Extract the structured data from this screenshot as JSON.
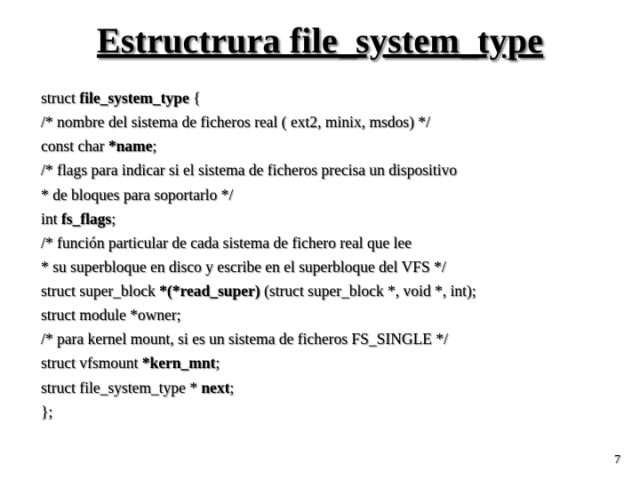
{
  "title": "Estructrura file_system_type",
  "code": {
    "l1a": "struct ",
    "l1b": "file_system_type",
    "l1c": " {",
    "l2": "/* nombre del sistema de ficheros real ( ext2, minix, msdos) */",
    "l3a": "const char ",
    "l3b": "*name",
    "l3c": ";",
    "l4": "/* flags para indicar si el sistema de ficheros precisa un dispositivo",
    "l5": "* de bloques para soportarlo */",
    "l6a": "int ",
    "l6b": "fs_flags",
    "l6c": ";",
    "l7": "/* función particular de cada sistema de fichero real que lee",
    "l8": "* su superbloque en disco y escribe en el superbloque del VFS */",
    "l9a": "struct super_block ",
    "l9b": "*(*read_super)",
    "l9c": " (struct super_block *, void *, int);",
    "l10": "struct module *owner;",
    "l11": "/* para kernel mount, si es un sistema de ficheros FS_SINGLE */",
    "l12a": "struct vfsmount ",
    "l12b": "*kern_mnt",
    "l12c": ";",
    "l13a": "struct file_system_type * ",
    "l13b": "next",
    "l13c": ";",
    "l14": "};"
  },
  "page": "7"
}
